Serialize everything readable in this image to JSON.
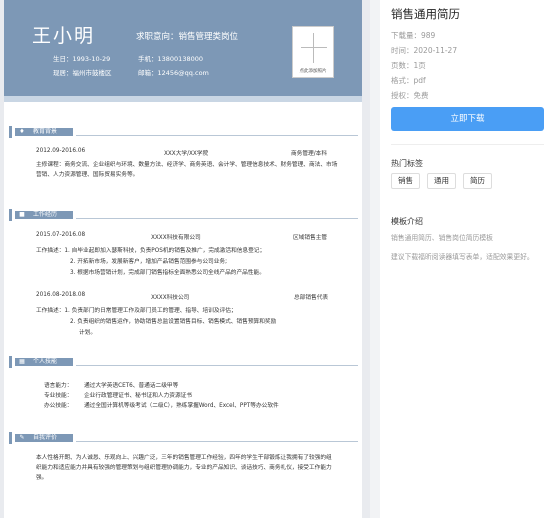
{
  "resume": {
    "header": {
      "name": "王小明",
      "intent": "求职意向：销售管理类岗位",
      "birthday": "生日：1993-10-29",
      "phone": "手机：13800138000",
      "residence": "现居：福州市鼓楼区",
      "email": "邮箱：12456@qq.com",
      "photo_caption": "点此添加照片"
    },
    "education": {
      "title": "教育背景",
      "period": "2012.09-2016.06",
      "school": "XXX大学/XX学院",
      "degree": "商务管理/本科",
      "courses": "主修课程：商务交流、企业组织与环境、数量方法、经济学、商务英语、会计学、管理信息技术、财务管理、商法、市场营销、人力资源管理、国际贸易实务等。"
    },
    "work": {
      "title": "工作经历",
      "jobs": [
        {
          "period": "2015.07-2016.08",
          "company": "XXXX科技有限公司",
          "role": "区域销售主管",
          "lines": [
            "工作描述：1. 自毕业起即加入瑟斯科技，负责POS机的销售及推广，完成激活和信息登记；",
            "2. 开拓新市场，发展新客户，增加产品销售范围参与公司业务;",
            "3. 根据市场营销计划，完成部门销售指标全面熟悉公司全线产品的产品性能。"
          ]
        },
        {
          "period": "2016.08-2018.08",
          "company": "XXXX科技公司",
          "role": "总部销售代表",
          "lines": [
            "工作描述：1. 负责部门的日常管理工作及部门员工的管理、指导、培训及评估；",
            "2. 负责组织的销售运作，协助销售总监设置销售目标、销售模式、销售预算和奖励",
            "计划。"
          ]
        }
      ]
    },
    "skills": {
      "title": "个人技能",
      "items": [
        {
          "label": "语言能力：",
          "value": "通过大学英语CET6、普通话二级甲等"
        },
        {
          "label": "专业技能：",
          "value": "企业行政管理证书、秘书证和人力资源证书"
        },
        {
          "label": "办公技能：",
          "value": "通过全国计算机等级考试（二级C），熟练掌握Word、Excel、PPT等办公软件"
        }
      ]
    },
    "evaluation": {
      "title": "自我评价",
      "text": "本人性格开朗、为人诚恳、乐观向上、兴趣广泛，三年的销售管理工作经验，四年的学生干部锻炼让我拥有了较强的组织能力和适应能力并具有较强的管理策划与组织管理协调能力，专业的产品知识、谈话技巧、商务礼仪，接受工作能力强。"
    }
  },
  "sidebar": {
    "title": "销售通用简历",
    "downloads": "下载量：989",
    "time": "时间：2020-11-27",
    "pages": "页数：1页",
    "format": "格式：pdf",
    "license": "授权：免费",
    "download_button": "立即下载",
    "tags_title": "热门标签",
    "tags": [
      "销售",
      "通用",
      "简历"
    ],
    "intro_title": "模板介绍",
    "intro_1": "销售通用简历、销售岗位简历模板",
    "intro_2": "建议下载福昕阅读器填写表单，适配效果更好。"
  },
  "colors": {
    "header": "#7d98b6",
    "accent_button": "#4a9ef5"
  },
  "icons": [
    "graduation-cap-icon",
    "briefcase-icon",
    "grid-icon",
    "pencil-icon"
  ]
}
